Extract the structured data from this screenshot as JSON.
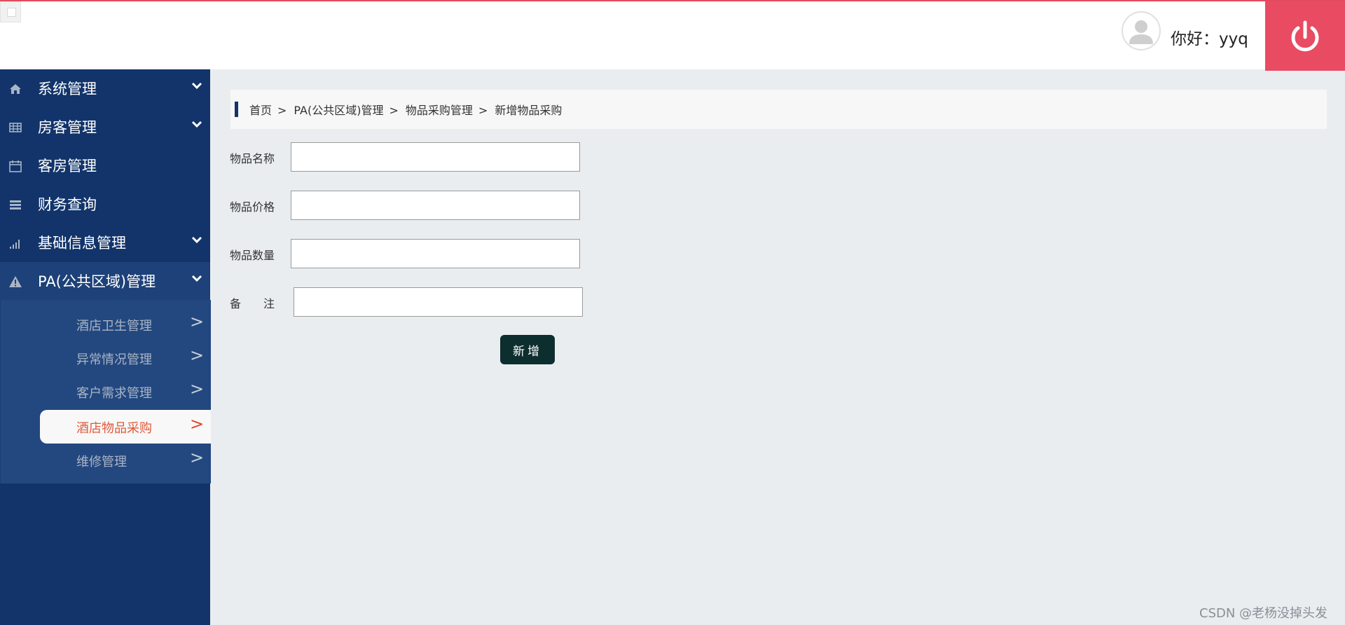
{
  "header": {
    "greeting": "你好：yyq",
    "avatar_icon": "user-avatar-icon",
    "power_icon": "power-icon",
    "accent_color": "#e94b62"
  },
  "sidebar": {
    "background": "#12346a",
    "items": [
      {
        "label": "系统管理",
        "icon": "home-icon",
        "has_chevron": true
      },
      {
        "label": "房客管理",
        "icon": "table-icon",
        "has_chevron": true
      },
      {
        "label": "客房管理",
        "icon": "calendar-icon",
        "has_chevron": false
      },
      {
        "label": "财务查询",
        "icon": "server-icon",
        "has_chevron": false
      },
      {
        "label": "基础信息管理",
        "icon": "signal-icon",
        "has_chevron": true
      },
      {
        "label": "PA(公共区域)管理",
        "icon": "warning-icon",
        "has_chevron": true
      }
    ],
    "submenu": [
      {
        "label": "酒店卫生管理",
        "arrow": ">"
      },
      {
        "label": "异常情况管理",
        "arrow": ">"
      },
      {
        "label": "客户需求管理",
        "arrow": ">"
      },
      {
        "label": "酒店物品采购",
        "arrow": ">",
        "selected": true
      },
      {
        "label": "维修管理",
        "arrow": ">"
      }
    ]
  },
  "breadcrumb": {
    "items": [
      "首页",
      "PA(公共区域)管理",
      "物品采购管理",
      "新增物品采购"
    ],
    "separator": ">"
  },
  "form": {
    "fields": [
      {
        "label": "物品名称",
        "value": ""
      },
      {
        "label": "物品价格",
        "value": ""
      },
      {
        "label": "物品数量",
        "value": ""
      },
      {
        "label": "备　　注",
        "value": ""
      }
    ],
    "submit_label": "新增"
  },
  "watermark": "CSDN @老杨没掉头发"
}
